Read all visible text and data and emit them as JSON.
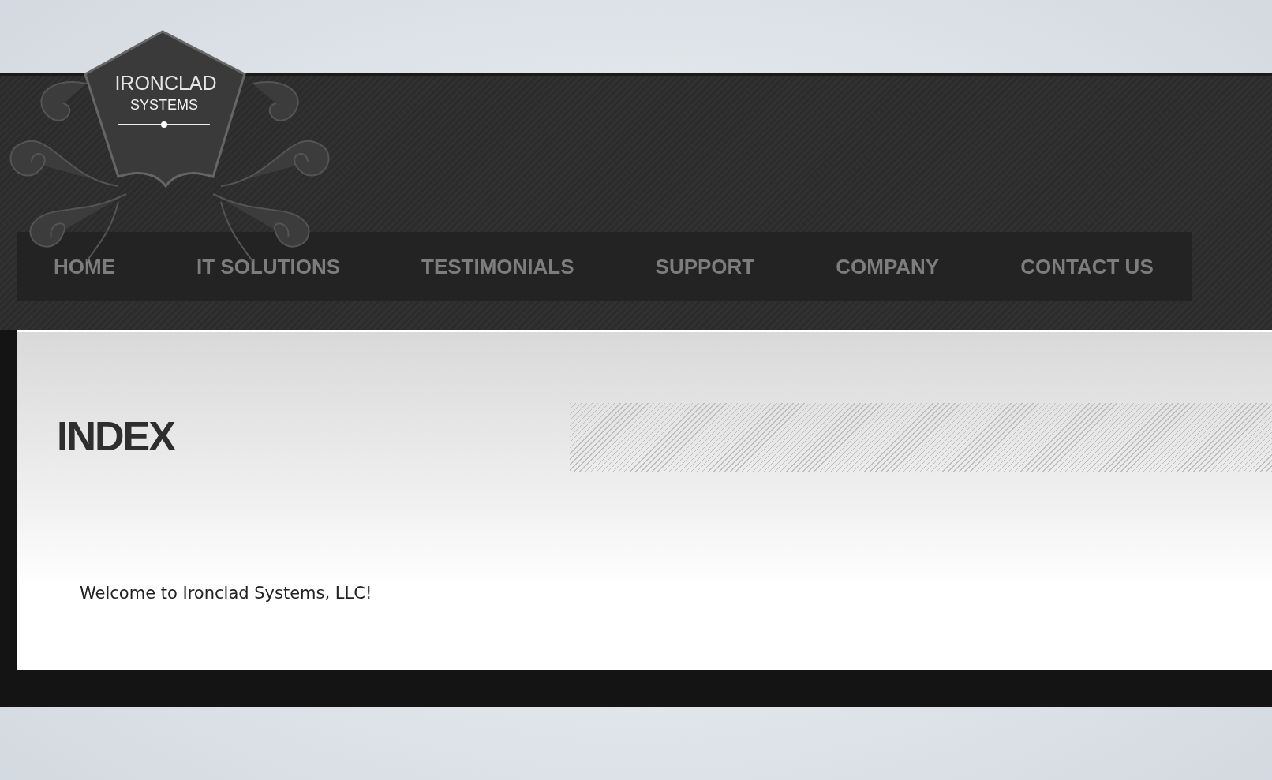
{
  "logo": {
    "name": "IRONCLAD",
    "tagline": "SYSTEMS"
  },
  "nav": [
    {
      "label": "HOME"
    },
    {
      "label": "IT SOLUTIONS"
    },
    {
      "label": "TESTIMONIALS"
    },
    {
      "label": "SUPPORT"
    },
    {
      "label": "COMPANY"
    },
    {
      "label": "CONTACT US"
    }
  ],
  "page": {
    "title": "INDEX",
    "welcome": "Welcome to Ironclad Systems, LLC!"
  }
}
